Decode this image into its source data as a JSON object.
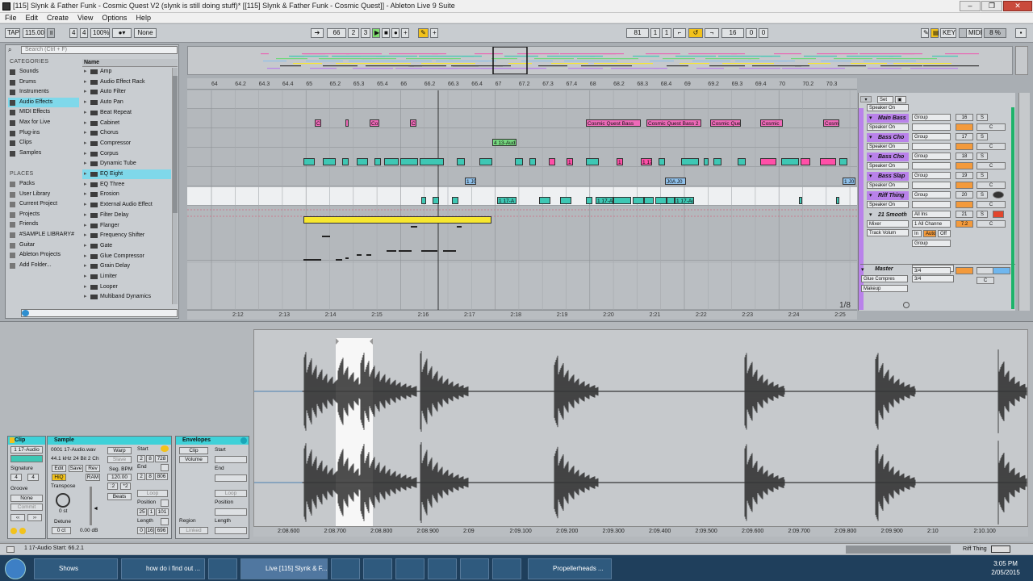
{
  "window": {
    "title": "[115] Slynk & Father Funk - Cosmic Quest V2 (slynk is still doing stuff)*  [[115] Slynk & Father Funk - Cosmic Quest]] - Ableton Live 9 Suite"
  },
  "menu": [
    "File",
    "Edit",
    "Create",
    "View",
    "Options",
    "Help"
  ],
  "control": {
    "tap": "TAP",
    "tempo": "115.00",
    "sig_num": "4",
    "sig_den": "4",
    "zoom": "100%",
    "metro": "1 Bar",
    "quant": "None",
    "pos_bar": "66",
    "pos_beat": "2",
    "pos_sixteenth": "3",
    "loop_start_bar": "81",
    "loop_start_beat": "1",
    "loop_start_six": "1",
    "loop_len_bar": "16",
    "loop_len_beat": "0",
    "loop_len_six": "0",
    "key": "KEY",
    "midi": "MIDI",
    "cpu": "8 %"
  },
  "browser": {
    "search_placeholder": "Search (Ctrl + F)",
    "categories_label": "CATEGORIES",
    "categories": [
      "Sounds",
      "Drums",
      "Instruments",
      "Audio Effects",
      "MIDI Effects",
      "Max for Live",
      "Plug-ins",
      "Clips",
      "Samples"
    ],
    "places_label": "PLACES",
    "places": [
      "Packs",
      "User Library",
      "Current Project",
      "Projects",
      "Friends",
      "#SAMPLE LIBRARY#",
      "Guitar",
      "Ableton Projects",
      "Add Folder..."
    ],
    "name_header": "Name",
    "items": [
      "Amp",
      "Audio Effect Rack",
      "Auto Filter",
      "Auto Pan",
      "Beat Repeat",
      "Cabinet",
      "Chorus",
      "Compressor",
      "Corpus",
      "Dynamic Tube",
      "EQ Eight",
      "EQ Three",
      "Erosion",
      "External Audio Effect",
      "Filter Delay",
      "Flanger",
      "Frequency Shifter",
      "Gate",
      "Glue Compressor",
      "Grain Delay",
      "Limiter",
      "Looper",
      "Multiband Dynamics"
    ]
  },
  "ruler": {
    "ticks": [
      "64",
      "64.2",
      "64.3",
      "64.4",
      "65",
      "65.2",
      "65.3",
      "65.4",
      "66",
      "66.2",
      "66.3",
      "66.4",
      "67",
      "67.2",
      "67.3",
      "67.4",
      "68",
      "68.2",
      "68.3",
      "68.4",
      "69",
      "69.2",
      "69.3",
      "69.4",
      "70",
      "70.2",
      "70.3"
    ]
  },
  "bottom_ruler": {
    "ticks": [
      "2:12",
      "2:13",
      "2:14",
      "2:15",
      "2:16",
      "2:17",
      "2:18",
      "2:19",
      "2:20",
      "2:21",
      "2:22",
      "2:23",
      "2:24",
      "2:25"
    ]
  },
  "clips": {
    "lane2": [
      "Co",
      "Co",
      "Co",
      "Co",
      "Cosmic Quest Bass",
      "Cosmic Quest Bass 2",
      "Cosmic Que",
      "Cosmic",
      "Cosm"
    ],
    "lane3": [
      "4 13-Aud"
    ],
    "lane4": [
      "1 17-A",
      "1 17-A",
      "1 17-A"
    ],
    "lane5": [
      "1 J0",
      "J0A J0",
      "1 J0"
    ],
    "lane6": [
      "1 17-A",
      "1 17-A",
      "1 17-Aud"
    ]
  },
  "tracks": [
    {
      "name": "Main Bass",
      "num": "16"
    },
    {
      "name": "Bass Cho",
      "num": "17"
    },
    {
      "name": "Bass Cho",
      "num": "18"
    },
    {
      "name": "Bass Slap",
      "num": "19"
    },
    {
      "name": "Riff Thing",
      "num": "20"
    },
    {
      "name": "21 Smooth",
      "num": "21"
    }
  ],
  "track_labels": {
    "speaker": "Speaker On",
    "group": "Group",
    "makeup": "Makeup",
    "all_ins": "All Ins",
    "all_channels": "1 All Channe",
    "mixer": "Mixer",
    "track_volume": "Track Volum",
    "in": "In",
    "auto": "Auto",
    "off": "Off",
    "set": "Set",
    "s": "S",
    "c": "C",
    "pan_value": "7.2",
    "master": "Master",
    "glue": "Glue Compres",
    "fraction": "3/4",
    "page": "1/8"
  },
  "clip_panel": {
    "title": "Clip",
    "clip_name": "1 17-Audio",
    "signature_label": "Signature",
    "sig_num": "4",
    "sig_den": "4",
    "groove_label": "Groove",
    "groove_value": "None",
    "commit": "Commit"
  },
  "sample_panel": {
    "title": "Sample",
    "file": "0001 17-Audio.wav",
    "format": "44.1 kHz 24 Bit 2 Ch",
    "edit": "Edit",
    "save": "Save",
    "rev": "Rev",
    "hiq": "HiQ",
    "ram": "RAM",
    "transpose_label": "Transpose",
    "transpose_value": "0 st",
    "detune_label": "Detune",
    "detune_value": "0 ct",
    "gain_value": "0.00 dB",
    "warp": "Warp",
    "slave": "Slave",
    "seg_bpm_label": "Seg. BPM",
    "seg_bpm": "120.00",
    "half": ":2",
    "double": "*2",
    "beats": "Beats",
    "start_label": "Start",
    "start_values": [
      "2",
      "8",
      "728"
    ],
    "end_label": "End",
    "end_values": [
      "2",
      "8",
      "806"
    ],
    "loop": "Loop",
    "position_label": "Position",
    "position_values": [
      "25",
      "1",
      "101"
    ],
    "length_label": "Length",
    "length_values": [
      "0",
      "16",
      "696"
    ]
  },
  "env_panel": {
    "title": "Envelopes",
    "clip": "Clip",
    "volume": "Volume",
    "start": "Start",
    "end": "End",
    "loop": "Loop",
    "position": "Position",
    "region": "Region",
    "linked": "Linked",
    "length": "Length"
  },
  "wave_ruler": {
    "ticks": [
      "2:08.600",
      "2:08.700",
      "2:08.800",
      "2:08.900",
      "2:09",
      "2:09.100",
      "2:09.200",
      "2:09.300",
      "2:09.400",
      "2:09.500",
      "2:09.600",
      "2:09.700",
      "2:09.800",
      "2:09.900",
      "2:10",
      "2:10.100"
    ]
  },
  "status": {
    "text": "1 17-Audio  Start: 66.2.1",
    "right": "Riff Thing"
  },
  "taskbar": {
    "items": [
      "Shows",
      "how do i find out ...",
      "",
      "Live  [115] Slynk & F...",
      "",
      "",
      "",
      "",
      "",
      "",
      "",
      "Propellerheads ..."
    ],
    "time": "3:05 PM",
    "date": "2/05/2015"
  }
}
